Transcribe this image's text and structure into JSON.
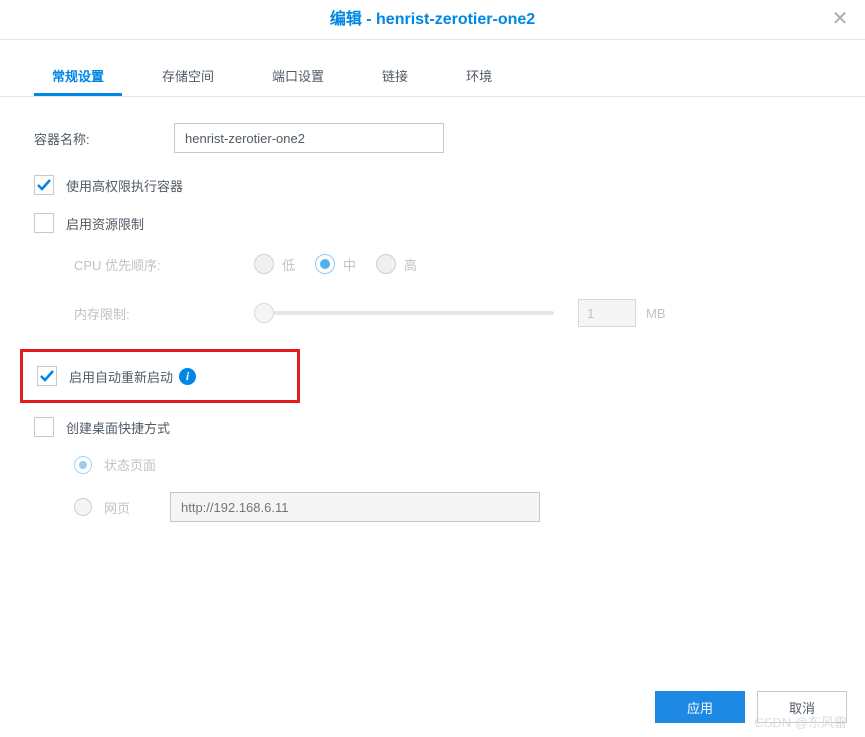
{
  "dialog": {
    "title": "编辑 - henrist-zerotier-one2"
  },
  "tabs": [
    {
      "label": "常规设置",
      "active": true
    },
    {
      "label": "存储空间",
      "active": false
    },
    {
      "label": "端口设置",
      "active": false
    },
    {
      "label": "链接",
      "active": false
    },
    {
      "label": "环境",
      "active": false
    }
  ],
  "container_name": {
    "label": "容器名称:",
    "value": "henrist-zerotier-one2"
  },
  "high_privilege": {
    "label": "使用高权限执行容器",
    "checked": true
  },
  "resource_limit": {
    "label": "启用资源限制",
    "checked": false
  },
  "cpu_priority": {
    "label": "CPU 优先顺序:",
    "options": {
      "low": "低",
      "mid": "中",
      "high": "高"
    },
    "selected": "mid"
  },
  "memory_limit": {
    "label": "内存限制:",
    "value": "1",
    "unit": "MB"
  },
  "auto_restart": {
    "label": "启用自动重新启动",
    "checked": true
  },
  "create_shortcut": {
    "label": "创建桌面快捷方式",
    "checked": false,
    "status_page": "状态页面",
    "webpage": "网页",
    "url_placeholder": "http://192.168.6.11"
  },
  "footer": {
    "apply": "应用",
    "cancel": "取消"
  },
  "watermark": "CSDN @东风雷"
}
